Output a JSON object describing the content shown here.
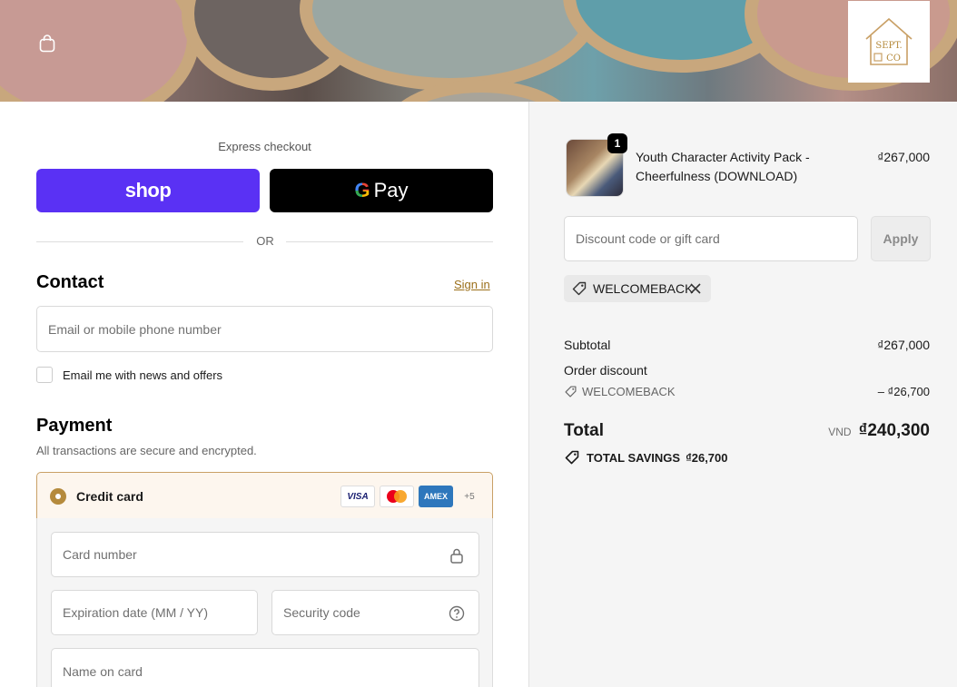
{
  "header": {
    "cart_icon": "shopping-bag-icon",
    "logo": {
      "line1": "SEPT.",
      "line2": "CO"
    }
  },
  "express": {
    "label": "Express checkout",
    "shop_label": "shop",
    "gpay_g": "G",
    "gpay_label": "Pay",
    "or_label": "OR"
  },
  "contact": {
    "title": "Contact",
    "sign_in": "Sign in",
    "email_placeholder": "Email or mobile phone number",
    "newsletter_label": "Email me with news and offers"
  },
  "payment": {
    "title": "Payment",
    "subtitle": "All transactions are secure and encrypted.",
    "method_label": "Credit card",
    "card_brands": [
      "VISA",
      "AMEX"
    ],
    "more_brands": "+5",
    "card_number_placeholder": "Card number",
    "expiry_placeholder": "Expiration date (MM / YY)",
    "security_placeholder": "Security code",
    "name_placeholder": "Name on card"
  },
  "summary": {
    "item": {
      "quantity": "1",
      "name_line1": "Youth Character Activity Pack -",
      "name_line2": "Cheerfulness (DOWNLOAD)",
      "price": "₫267,000"
    },
    "discount_placeholder": "Discount code or gift card",
    "apply_label": "Apply",
    "applied_code": "WELCOMEBACK",
    "subtotal_label": "Subtotal",
    "subtotal_value": "₫267,000",
    "order_discount_label": "Order discount",
    "order_discount_code": "WELCOMEBACK",
    "order_discount_value": "– ₫26,700",
    "total_label": "Total",
    "currency": "VND",
    "total_value": "₫240,300",
    "savings_label": "TOTAL SAVINGS",
    "savings_value": "₫26,700"
  },
  "colors": {
    "shop_purple": "#5a31f4",
    "accent_gold": "#b58a3c",
    "link_gold": "#9b6f1a"
  }
}
